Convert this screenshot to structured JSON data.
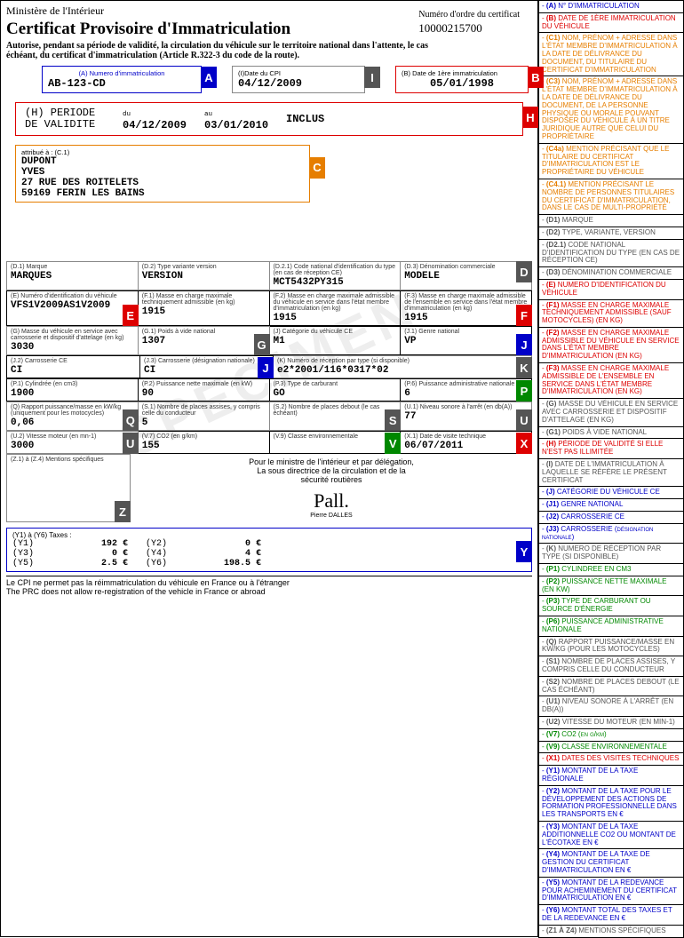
{
  "header": {
    "ministry": "Ministère de l'Intérieur",
    "title": "Certificat Provisoire d'Immatriculation",
    "auth": "Autorise, pendant sa période de validité, la circulation du véhicule sur le territoire national dans l'attente, le cas échéant, du certificat d'immatriculation (Article R.322-3 du code de la route).",
    "num_ord_label": "Numéro d'ordre du certificat",
    "num_ord": "10000215700"
  },
  "fields": {
    "A": {
      "label": "(A) Numero d'immatriculation",
      "value": "AB-123-CD"
    },
    "I": {
      "label": "(I)Date du CPI",
      "value": "04/12/2009"
    },
    "B": {
      "label": "(B) Date de 1ère immatriculation",
      "value": "05/01/1998"
    },
    "H": {
      "title": "(H) PERIODE DE VALIDITE",
      "du_lbl": "du",
      "du": "04/12/2009",
      "au_lbl": "au",
      "au": "03/01/2010",
      "incl": "INCLUS"
    },
    "C": {
      "label": "attribué à : (C.1)",
      "name": "DUPONT\nYVES\n27 RUE DES ROITELETS\n59169 FERIN LES BAINS"
    },
    "D1": {
      "label": "(D.1) Marque",
      "value": "MARQUES"
    },
    "D2": {
      "label": "(D.2) Type variante version",
      "value": "VERSION"
    },
    "D21": {
      "label": "(D.2.1) Code national d'identification du type (en cas de réception CE)",
      "value": "MCT5432PY315"
    },
    "D3": {
      "label": "(D.3) Dénomination commerciale",
      "value": "MODELE"
    },
    "E": {
      "label": "(E) Numéro d'identification du véhicule",
      "value": "VFS1V2009AS1V2009"
    },
    "F1": {
      "label": "(F.1) Masse en charge maximale techniquement admissible (en kg)",
      "value": "1915"
    },
    "F2": {
      "label": "(F.2) Masse en charge maximale admissible du véhicule en service dans l'état membre d'immatriculation (en kg)",
      "value": "1915"
    },
    "F3": {
      "label": "(F.3) Masse en charge maximale admissible de l'ensemble en service dans l'état membre d'immatriculation (en kg)",
      "value": "1915"
    },
    "G": {
      "label": "(G) Masse du véhicule en service avec carrosserie et dispositif d'attelage (en kg)",
      "value": "3030"
    },
    "G1": {
      "label": "(G.1) Poids à vide national",
      "value": "1307"
    },
    "J": {
      "label": "(J) Catégorie du véhicule CE",
      "value": "M1"
    },
    "J1": {
      "label": "(J.1) Genre national",
      "value": "VP"
    },
    "J2": {
      "label": "(J.2) Carrosserie CE",
      "value": "CI"
    },
    "J3": {
      "label": "(J.3) Carrosserie (désignation nationale)",
      "value": "CI"
    },
    "K": {
      "label": "(K) Numéro de réception par type (si disponible)",
      "value": "e2*2001/116*0317*02"
    },
    "P1": {
      "label": "(P.1) Cylindrée (en cm3)",
      "value": "1900"
    },
    "P2": {
      "label": "(P.2) Puissance nette maximale (en kW)",
      "value": "90"
    },
    "P3": {
      "label": "(P.3) Type de carburant",
      "value": "GO"
    },
    "P6": {
      "label": "(P.6) Puissance administrative nationale",
      "value": "6"
    },
    "Q": {
      "label": "(Q) Rapport puissance/masse en kW/kg (uniquement pour les motocycles)",
      "value": "0,06"
    },
    "S1": {
      "label": "(S.1) Nombre de places assises, y compris celle du conducteur",
      "value": "5"
    },
    "S2": {
      "label": "(S.2) Nombre de places debout (le cas échéant)",
      "value": ""
    },
    "U1": {
      "label": "(U.1) Niveau sonore à l'arrêt (en db(A))",
      "value": "77"
    },
    "U2": {
      "label": "(U.2) Vitesse moteur (en mn-1)",
      "value": "3000"
    },
    "V7": {
      "label": "(V.7) CO2 (en g/km)",
      "value": "155"
    },
    "V9": {
      "label": "(V.9) Classe environnementale",
      "value": ""
    },
    "X1": {
      "label": "(X.1) Date de visite technique",
      "value": "06/07/2011"
    },
    "Z": {
      "label": "(Z.1) à (Z.4) Mentions spécifiques",
      "value": ""
    },
    "Y": {
      "header": "(Y1) à (Y6) Taxes :",
      "Y1": {
        "label": "(Y1)",
        "value": "192 €"
      },
      "Y2": {
        "label": "(Y2)",
        "value": "0 €"
      },
      "Y3": {
        "label": "(Y3)",
        "value": "0 €"
      },
      "Y4": {
        "label": "(Y4)",
        "value": "4 €"
      },
      "Y5": {
        "label": "(Y5)",
        "value": "2.5 €"
      },
      "Y6": {
        "label": "(Y6)",
        "value": "198.5 €"
      }
    }
  },
  "signature": {
    "line1": "Pour le ministre de l'intérieur et par délégation,",
    "line2": "La sous directrice de la circulation et de la",
    "line3": "sécurité routières",
    "name": "Pierre DALLES"
  },
  "footer": {
    "fr": "Le CPI ne permet pas la réimmatriculation du véhicule en France ou à l'étranger",
    "en": "The PRC does not allow re-registration of the vehicle in France or abroad"
  },
  "legend": [
    {
      "letter": "A",
      "text": "N° D'IMMATRICULATION",
      "color": "blue"
    },
    {
      "letter": "B",
      "text": "DATE DE 1ÈRE IMMATRICULATION DU VÉHICULE",
      "color": "red"
    },
    {
      "letter": "C1",
      "text": "NOM, PRÉNOM + ADRESSE DANS L'ÉTAT MEMBRE D'IMMATRICULATION À LA DATE DE DÉLIVRANCE DU DOCUMENT, DU TITULAIRE DU CERTIFICAT D'IMMATRICULATION",
      "color": "orange"
    },
    {
      "letter": "C3",
      "text": "NOM, PRÉNOM + ADRESSE DANS L'ÉTAT MEMBRE D'IMMATRICULATION À LA DATE DE DÉLIVRANCE DU DOCUMENT, DE LA PERSONNE PHYSIQUE OU MORALE POUVANT DISPOSER DU VÉHICULE À UN TITRE JURIDIQUE AUTRE QUE CELUI DU PROPRIÉTAIRE",
      "color": "orange"
    },
    {
      "letter": "C4a",
      "text": "MENTION PRÉCISANT QUE LE TITULAIRE DU CERTIFICAT D'IMMATRICULATION EST LE PROPRIÉTAIRE DU VÉHICULE",
      "color": "orange"
    },
    {
      "letter": "C4.1",
      "text": "MENTION PRÉCISANT LE NOMBRE DE PERSONNES TITULAIRES DU CERTIFICAT D'IMMATRICULATION, DANS LE CAS DE MULTI-PROPRIÉTÉ",
      "color": "orange"
    },
    {
      "letter": "D1",
      "text": "MARQUE",
      "color": "gray"
    },
    {
      "letter": "D2",
      "text": "TYPE, VARIANTE, VERSION",
      "color": "gray"
    },
    {
      "letter": "D2.1",
      "text": "CODE NATIONAL D'IDENTIFICATION DU TYPE (EN CAS DE RÉCEPTION CE)",
      "color": "gray"
    },
    {
      "letter": "D3",
      "text": "DÉNOMINATION COMMERCIALE",
      "color": "gray"
    },
    {
      "letter": "E",
      "text": "NUMERO D'IDENTIFICATION DU VÉHICULE",
      "color": "red"
    },
    {
      "letter": "F1",
      "text": "MASSE EN CHARGE MAXIMALE TECHNIQUEMENT ADMISSIBLE (SAUF MOTOCYCLES) (EN KG)",
      "color": "red"
    },
    {
      "letter": "F2",
      "text": "MASSE EN CHARGE MAXIMALE ADMISSIBLE DU VÉHICULE EN SERVICE DANS L'ÉTAT MEMBRE D'IMMATRICULATION (EN KG)",
      "color": "red"
    },
    {
      "letter": "F3",
      "text": "MASSE EN CHARGE MAXIMALE ADMISSIBLE DE L'ENSEMBLE EN SERVICE DANS L'ÉTAT MEMBRE D'IMMATRICULATION (EN KG)",
      "color": "red"
    },
    {
      "letter": "G",
      "text": "MASSE DU VÉHICULE EN SERVICE AVEC CARROSSERIE ET DISPOSITIF D'ATTELAGE (EN KG)",
      "color": "gray"
    },
    {
      "letter": "G1",
      "text": "POIDS À VIDE NATIONAL",
      "color": "gray"
    },
    {
      "letter": "H",
      "text": "PÉRIODE DE VALIDITÉ SI ELLE N'EST PAS ILLIMITÉE",
      "color": "red"
    },
    {
      "letter": "I",
      "text": "DATE DE L'IMMATRICULATION À LAQUELLE SE RÉFÈRE LE PRÉSENT CERTIFICAT",
      "color": "gray"
    },
    {
      "letter": "J",
      "text": "CATÉGORIE DU VÉHICULE CE",
      "color": "blue"
    },
    {
      "letter": "J1",
      "text": "GENRE NATIONAL",
      "color": "blue"
    },
    {
      "letter": "J2",
      "text": "CARROSSERIE CE",
      "color": "blue"
    },
    {
      "letter": "J3",
      "text": "CARROSSERIE (désignation nationale)",
      "color": "blue"
    },
    {
      "letter": "K",
      "text": "NUMERO DE RÉCEPTION PAR TYPE (SI DISPONIBLE)",
      "color": "gray"
    },
    {
      "letter": "P1",
      "text": "CYLINDREE EN CM3",
      "color": "green"
    },
    {
      "letter": "P2",
      "text": "PUISSANCE NETTE MAXIMALE (EN KW)",
      "color": "green"
    },
    {
      "letter": "P3",
      "text": "TYPE DE CARBURANT OU SOURCE D'ÉNERGIE",
      "color": "green"
    },
    {
      "letter": "P6",
      "text": "PUISSANCE ADMINISTRATIVE NATIONALE",
      "color": "green"
    },
    {
      "letter": "Q",
      "text": "RAPPORT PUISSANCE/MASSE EN KW/KG (POUR LES MOTOCYCLES)",
      "color": "gray"
    },
    {
      "letter": "S1",
      "text": "NOMBRE DE PLACES ASSISES, Y COMPRIS CELLE DU CONDUCTEUR",
      "color": "gray"
    },
    {
      "letter": "S2",
      "text": "NOMBRE DE PLACES DEBOUT (LE CAS ÉCHÉANT)",
      "color": "gray"
    },
    {
      "letter": "U1",
      "text": "NIVEAU SONORE À L'ARRÊT (EN DB(A))",
      "color": "gray"
    },
    {
      "letter": "U2",
      "text": "VITESSE DU MOTEUR (EN MIN-1)",
      "color": "gray"
    },
    {
      "letter": "V7",
      "text": "CO2 (en g/km)",
      "color": "green"
    },
    {
      "letter": "V9",
      "text": "CLASSE ENVIRONNEMENTALE",
      "color": "green"
    },
    {
      "letter": "X1",
      "text": "DATES DES VISITES TECHNIQUES",
      "color": "red"
    },
    {
      "letter": "Y1",
      "text": "MONTANT DE LA TAXE RÉGIONALE",
      "color": "blue"
    },
    {
      "letter": "Y2",
      "text": "MONTANT DE LA TAXE POUR LE DÉVELOPPEMENT DES ACTIONS DE FORMATION PROFESSIONNELLE DANS LES TRANSPORTS EN €",
      "color": "blue"
    },
    {
      "letter": "Y3",
      "text": "MONTANT DE LA TAXE ADDITIONNELLE CO2 OU MONTANT DE L'ÉCOTAXE EN €",
      "color": "blue"
    },
    {
      "letter": "Y4",
      "text": "MONTANT DE LA TAXE DE GESTION DU CERTIFICAT D'IMMATRICULATION EN €",
      "color": "blue"
    },
    {
      "letter": "Y5",
      "text": "MONTANT DE LA REDEVANCE POUR ACHEMINEMENT DU CERTIFICAT D'IMMATRICULATION EN €",
      "color": "blue"
    },
    {
      "letter": "Y6",
      "text": "MONTANT TOTAL DES TAXES ET DE LA REDEVANCE EN €",
      "color": "blue"
    },
    {
      "letter": "Z1 À Z4",
      "text": "MENTIONS SPÉCIFIQUES",
      "color": "gray"
    }
  ]
}
